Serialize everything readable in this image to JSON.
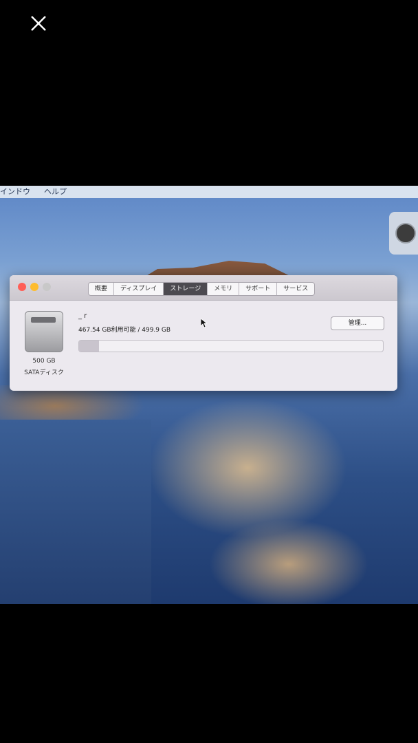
{
  "viewer": {
    "close_icon": "close-icon"
  },
  "menubar": {
    "item_window": "インドウ",
    "item_help": "ヘルプ"
  },
  "window": {
    "tabs": [
      {
        "label": "概要"
      },
      {
        "label": "ディスプレイ"
      },
      {
        "label": "ストレージ",
        "active": true
      },
      {
        "label": "メモリ"
      },
      {
        "label": "サポート"
      },
      {
        "label": "サービス"
      }
    ],
    "disk": {
      "capacity_label": "500 GB",
      "type_label": "SATAディスク",
      "name": "_ r",
      "usage_text": "467.54 GB利用可能 / 499.9 GB",
      "used_fraction": 0.065
    },
    "manage_label": "管理..."
  },
  "colors": {
    "close": "#ff5f57",
    "minimize": "#febc2e",
    "zoom": "#c8c8c8"
  }
}
